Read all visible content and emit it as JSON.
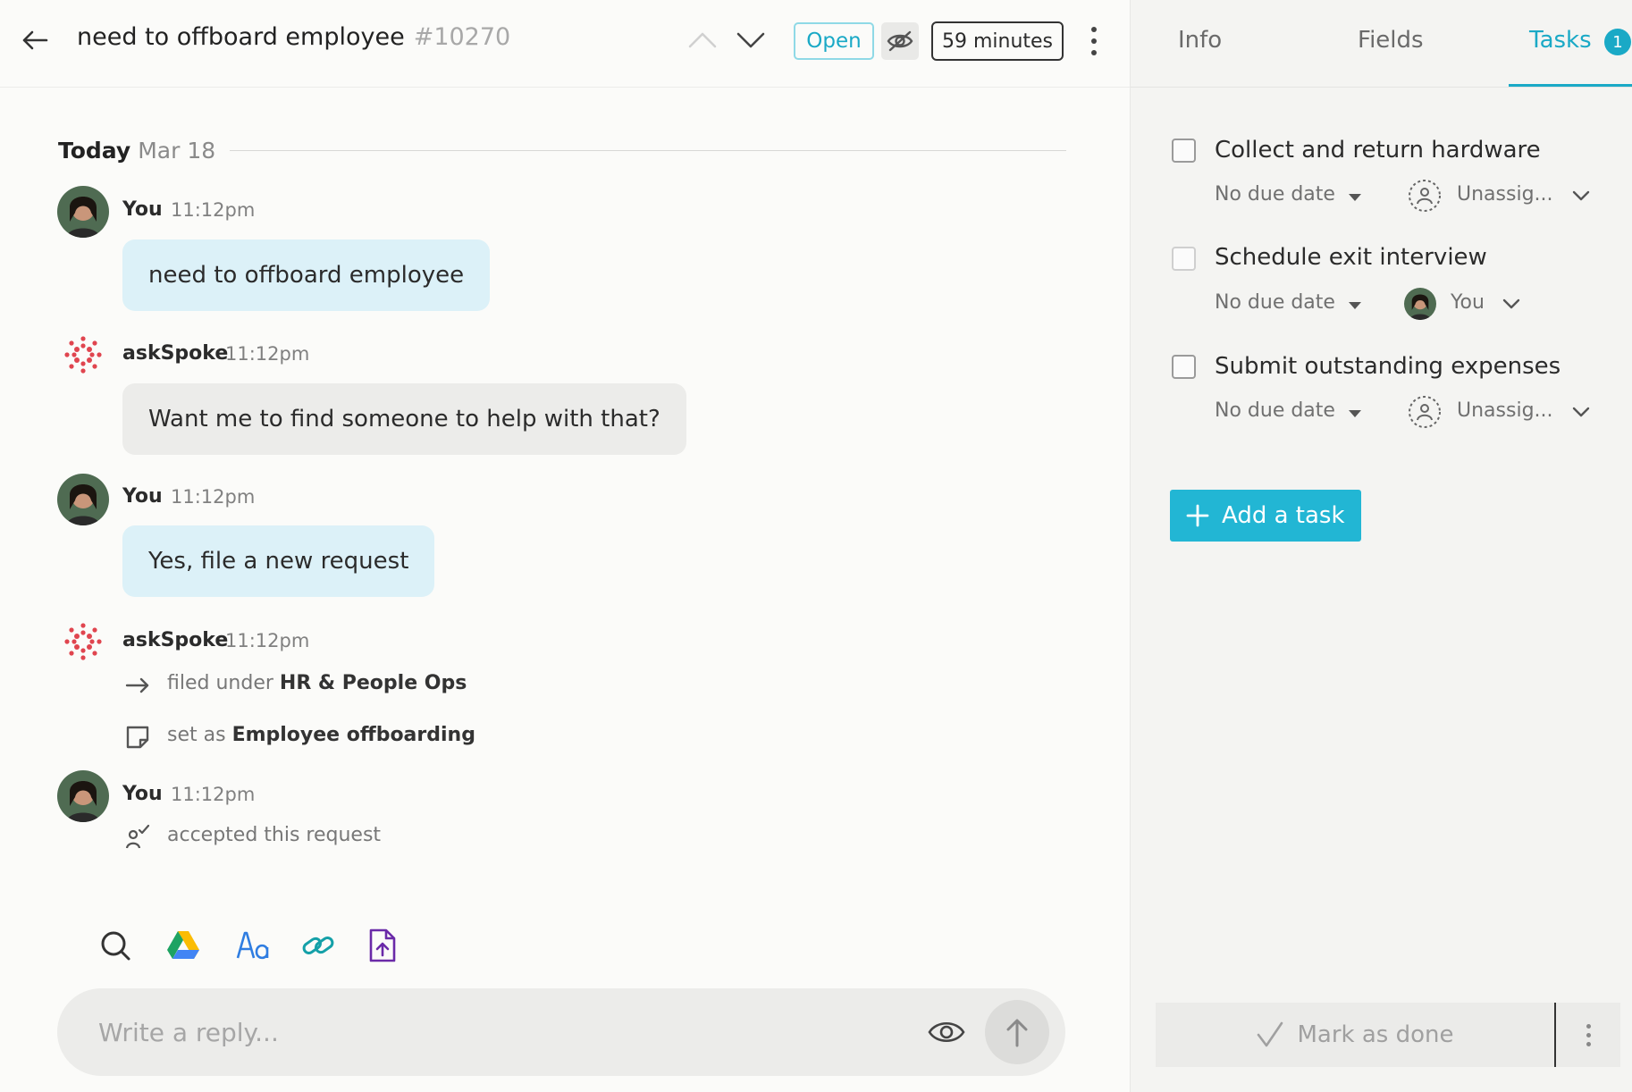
{
  "header": {
    "title": "need to offboard employee",
    "ticket_number": "#10270",
    "status": "Open",
    "timer": "59 minutes"
  },
  "conversation": {
    "date_today": "Today",
    "date_value": "Mar 18",
    "messages": [
      {
        "author": "You",
        "time": "11:12pm",
        "text": "need to offboard employee"
      },
      {
        "author": "askSpoke",
        "time": "11:12pm",
        "text": "Want me to find someone to help with that?"
      },
      {
        "author": "You",
        "time": "11:12pm",
        "text": "Yes, file a new request"
      },
      {
        "author": "askSpoke",
        "time": "11:12pm"
      },
      {
        "author": "You",
        "time": "11:12pm"
      }
    ],
    "events": [
      {
        "prefix": "filed under",
        "value": "HR & People Ops"
      },
      {
        "prefix": "set as",
        "value": "Employee offboarding"
      },
      {
        "prefix": "accepted this request"
      }
    ]
  },
  "composer": {
    "placeholder": "Write a reply..."
  },
  "tabs": [
    {
      "label": "Info"
    },
    {
      "label": "Fields"
    },
    {
      "label": "Tasks",
      "count": "1"
    }
  ],
  "tasks": [
    {
      "title": "Collect and return hardware",
      "due": "No due date",
      "assignee": "Unassig..."
    },
    {
      "title": "Schedule exit interview",
      "due": "No due date",
      "assignee": "You"
    },
    {
      "title": "Submit outstanding expenses",
      "due": "No due date",
      "assignee": "Unassig..."
    }
  ],
  "actions": {
    "add_task": "Add a task",
    "mark_done": "Mark as done"
  },
  "colors": {
    "accent": "#1aa9c6",
    "button": "#22b6d4",
    "my_bubble": "#dcf1f8",
    "bot_bubble": "#ececea",
    "bot_logo": "#e0454f"
  }
}
